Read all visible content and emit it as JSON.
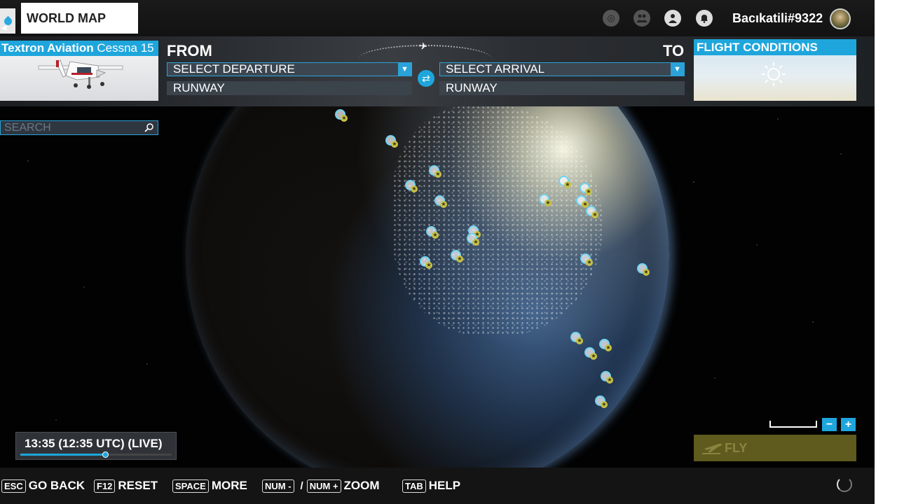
{
  "header": {
    "title": "WORLD MAP",
    "username": "Bacıkatili#9322"
  },
  "aircraft": {
    "manufacturer": "Textron Aviation",
    "model": "Cessna 15"
  },
  "route": {
    "from_label": "FROM",
    "to_label": "TO",
    "departure_placeholder": "SELECT DEPARTURE",
    "arrival_placeholder": "SELECT ARRIVAL",
    "departure_runway": "RUNWAY",
    "arrival_runway": "RUNWAY"
  },
  "conditions": {
    "title": "FLIGHT CONDITIONS",
    "weather_icon": "sun-icon"
  },
  "search": {
    "placeholder": "SEARCH"
  },
  "time": {
    "label": "13:35 (12:35 UTC) (LIVE)",
    "progress": 0.56
  },
  "fly": {
    "label": "FLY"
  },
  "bottom_hints": [
    {
      "key": "ESC",
      "label": "GO BACK"
    },
    {
      "key": "F12",
      "label": "RESET"
    },
    {
      "key": "SPACE",
      "label": "MORE"
    },
    {
      "key": "NUM -",
      "key2": "NUM +",
      "separator": "/",
      "label": "ZOOM"
    },
    {
      "key": "TAB",
      "label": "HELP"
    }
  ],
  "colors": {
    "accent": "#1ea6dc",
    "fly_disabled": "#5f5a1d"
  }
}
